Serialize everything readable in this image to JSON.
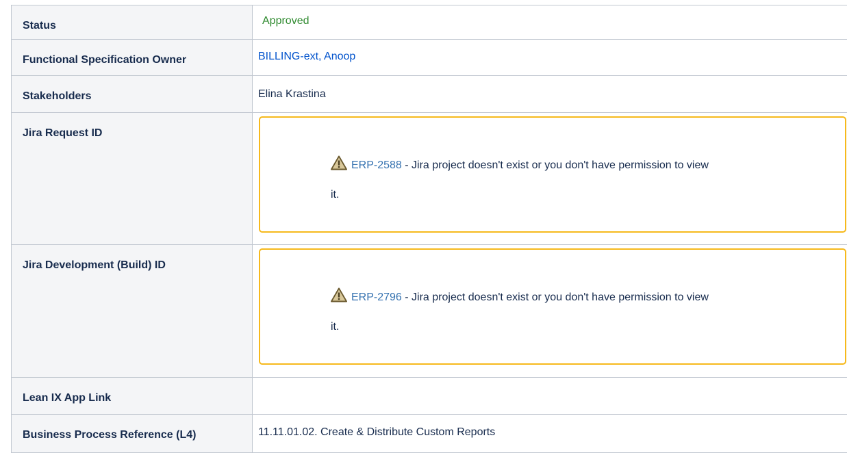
{
  "rows": {
    "status": {
      "label": "Status",
      "value": "Approved"
    },
    "owner": {
      "label": "Functional Specification Owner",
      "value": "BILLING-ext, Anoop"
    },
    "stakeholders": {
      "label": "Stakeholders",
      "value": "Elina Krastina"
    },
    "jira_request": {
      "label": "Jira Request ID",
      "issue_key": "ERP-2588",
      "message": " - Jira project doesn't exist or you don't have permission to view",
      "message_tail": "it."
    },
    "jira_build": {
      "label": "Jira Development (Build) ID",
      "issue_key": "ERP-2796",
      "message": " - Jira project doesn't exist or you don't have permission to view",
      "message_tail": "it."
    },
    "lean_ix": {
      "label": "Lean IX App Link",
      "value": ""
    },
    "bpr": {
      "label": "Business Process Reference (L4)",
      "value": "11.11.01.02. Create & Distribute Custom Reports"
    }
  },
  "icons": {
    "warning": "warning-triangle-icon"
  },
  "colors": {
    "status_approved": "#2f8a2f",
    "link": "#0052cc",
    "issue_key": "#3572b0",
    "warning_border": "#f6b91c",
    "header_bg": "#f4f5f7",
    "border": "#c1c7d0"
  }
}
